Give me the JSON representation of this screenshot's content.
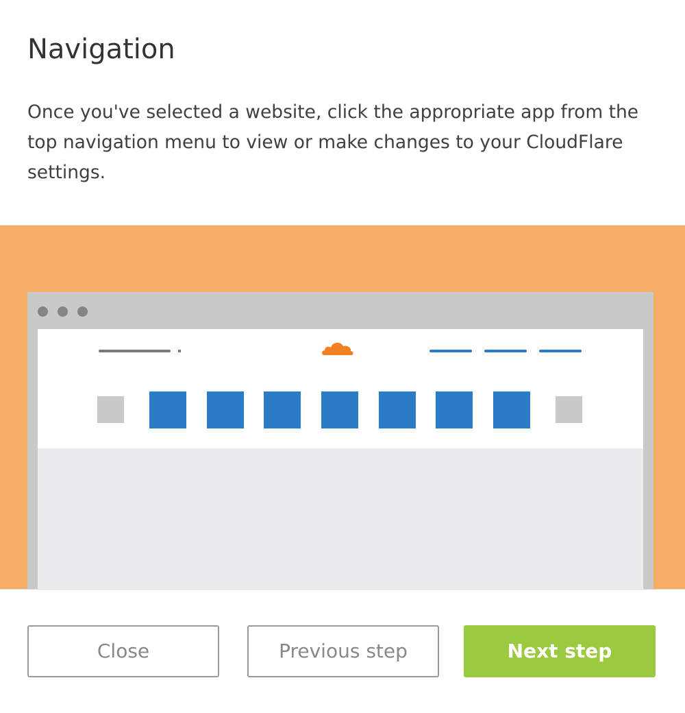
{
  "dialog": {
    "title": "Navigation",
    "description": "Once you've selected a website, click the appropriate app from the top navigation menu to view or make changes to your CloudFlare settings."
  },
  "illustration": {
    "background_color": "#f6ae67",
    "accent_color": "#2a7cc7",
    "logo_icon": "cloud-icon",
    "logo_color": "#f38020",
    "app_tile_count": 7
  },
  "buttons": {
    "close_label": "Close",
    "previous_label": "Previous step",
    "next_label": "Next step",
    "next_color": "#9bc93f"
  }
}
